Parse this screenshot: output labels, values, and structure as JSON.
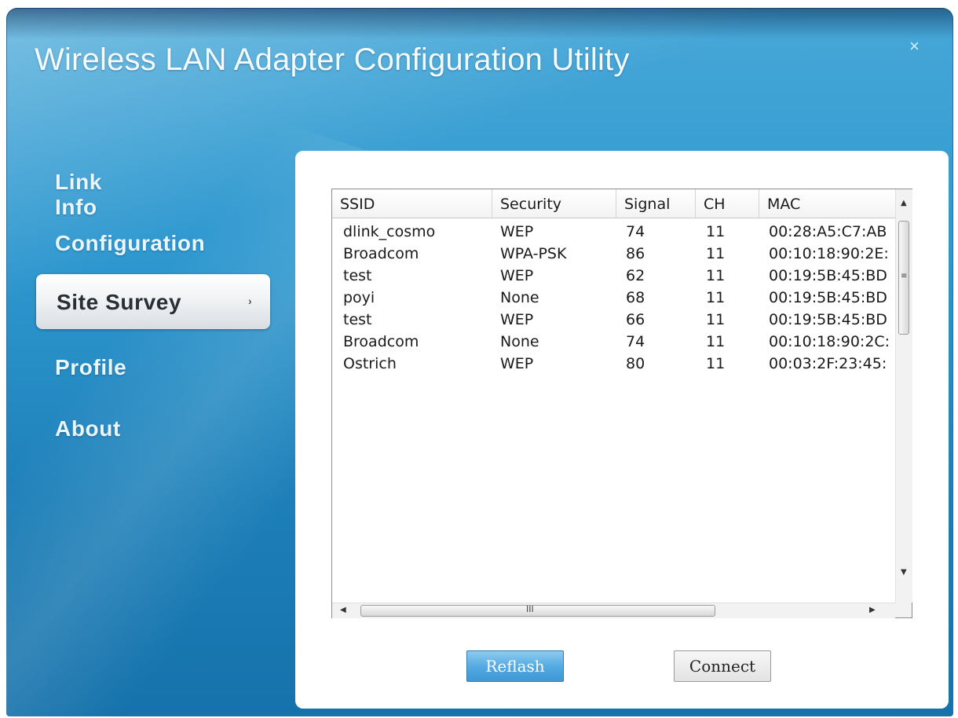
{
  "window": {
    "title": "Wireless LAN Adapter Configuration Utility",
    "close_glyph": "×"
  },
  "sidebar": {
    "items": [
      {
        "label": "Link Info",
        "active": false
      },
      {
        "label": "Configuration",
        "active": false
      },
      {
        "label": "Site Survey",
        "active": true
      },
      {
        "label": "Profile",
        "active": false
      },
      {
        "label": "About",
        "active": false
      }
    ],
    "active_arrow": "›"
  },
  "survey": {
    "columns": [
      "SSID",
      "Security",
      "Signal",
      "CH",
      "MAC"
    ],
    "rows": [
      [
        "dlink_cosmo",
        "WEP",
        "74",
        "11",
        "00:28:A5:C7:AB"
      ],
      [
        "Broadcom",
        "WPA-PSK",
        "86",
        "11",
        "00:10:18:90:2E:"
      ],
      [
        "test",
        "WEP",
        "62",
        "11",
        "00:19:5B:45:BD"
      ],
      [
        "poyi",
        "None",
        "68",
        "11",
        "00:19:5B:45:BD"
      ],
      [
        "test",
        "WEP",
        "66",
        "11",
        "00:19:5B:45:BD"
      ],
      [
        "Broadcom",
        "None",
        "74",
        "11",
        "00:10:18:90:2C:"
      ],
      [
        "Ostrich",
        "WEP",
        "80",
        "11",
        "00:03:2F:23:45:"
      ]
    ],
    "scroll_grip_h": "III",
    "scroll_grip_v": "≡"
  },
  "buttons": {
    "refresh": "Reflash",
    "connect": "Connect"
  },
  "colors": {
    "window_blue": "#2f98cf",
    "active_nav_bg": "#f1f3f5",
    "refresh_button": "#55abe1"
  }
}
